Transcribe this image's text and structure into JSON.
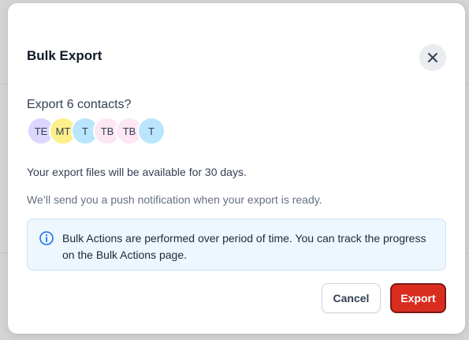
{
  "modal": {
    "title": "Bulk Export",
    "question": "Export 6 contacts?",
    "avatars": [
      {
        "initials": "TE",
        "color": "#ddd6fe"
      },
      {
        "initials": "MT",
        "color": "#fdf08a"
      },
      {
        "initials": "T",
        "color": "#bae6fd"
      },
      {
        "initials": "TB",
        "color": "#fce7f3"
      },
      {
        "initials": "TB",
        "color": "#fce7f3"
      },
      {
        "initials": "T",
        "color": "#bae6fd"
      }
    ],
    "availability_text": "Your export files will be available for 30 days.",
    "notification_text": "We’ll send you a push notification when your export is ready.",
    "info_text": "Bulk Actions are performed over period of time. You can track the progress on the Bulk Actions page.",
    "cancel_label": "Cancel",
    "export_label": "Export"
  },
  "colors": {
    "primary_danger": "#d92d20",
    "info_bg": "#eef6fe",
    "info_icon": "#1570ef"
  },
  "icons": {
    "close": "close-icon",
    "info": "info-circle-icon"
  }
}
